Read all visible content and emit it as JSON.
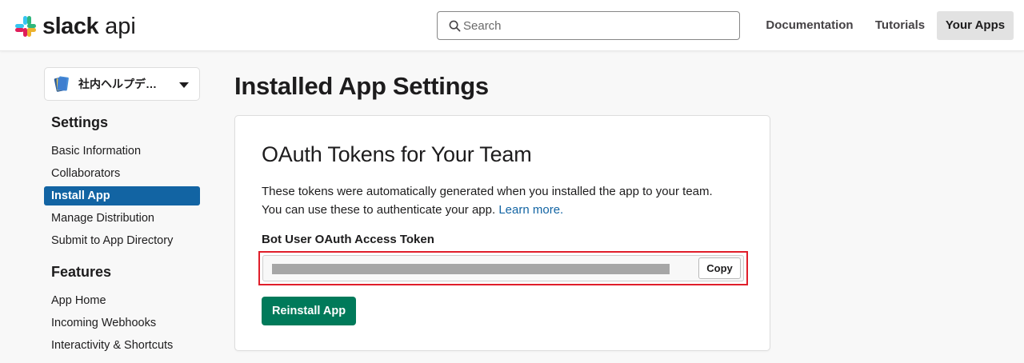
{
  "header": {
    "brand": "slack",
    "brand_suffix": "api",
    "search_placeholder": "Search",
    "nav": {
      "documentation": "Documentation",
      "tutorials": "Tutorials",
      "your_apps": "Your Apps"
    }
  },
  "sidebar": {
    "app_name": "社内ヘルプデ…",
    "settings_heading": "Settings",
    "settings_items": [
      {
        "label": "Basic Information"
      },
      {
        "label": "Collaborators"
      },
      {
        "label": "Install App",
        "active": true
      },
      {
        "label": "Manage Distribution"
      },
      {
        "label": "Submit to App Directory"
      }
    ],
    "features_heading": "Features",
    "features_items": [
      {
        "label": "App Home"
      },
      {
        "label": "Incoming Webhooks"
      },
      {
        "label": "Interactivity & Shortcuts"
      }
    ]
  },
  "main": {
    "page_title": "Installed App Settings",
    "card": {
      "title": "OAuth Tokens for Your Team",
      "desc_line1": "These tokens were automatically generated when you installed the app to your team.",
      "desc_line2": "You can use these to authenticate your app.",
      "learn_more": "Learn more.",
      "token_label": "Bot User OAuth Access Token",
      "copy_label": "Copy",
      "reinstall_label": "Reinstall App"
    }
  },
  "colors": {
    "active_item": "#1264a3",
    "link": "#1264a3",
    "reinstall_button": "#007a5a",
    "highlight_border": "#e01e2a"
  }
}
